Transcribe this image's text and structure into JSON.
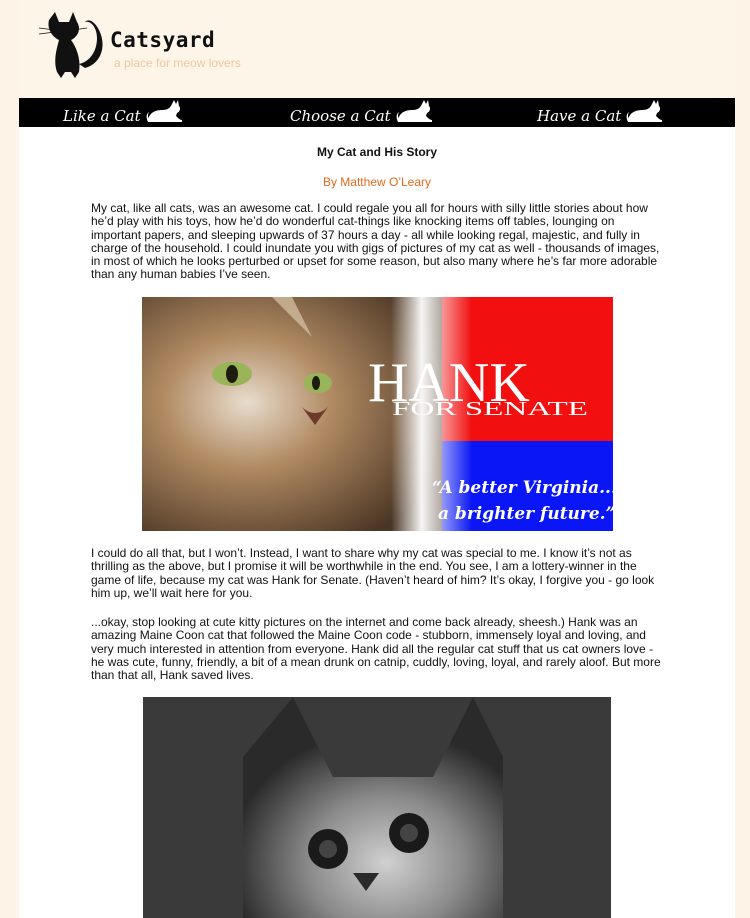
{
  "site": {
    "title": "Catsyard",
    "tagline": "a place for meow lovers"
  },
  "nav": {
    "items": [
      {
        "label": "Like a Cat",
        "icon": "cat-icon"
      },
      {
        "label": "Choose a Cat",
        "icon": "cat-icon"
      },
      {
        "label": "Have a Cat",
        "icon": "cat-icon"
      }
    ]
  },
  "article": {
    "title": "My Cat and His Story",
    "author": "By Matthew O’Leary",
    "paragraphs": [
      "My cat, like all cats, was an awesome cat. I could regale you all for hours with silly little stories about how he’d play with his toys, how he’d do wonderful cat-things like knocking items off tables, lounging on important papers, and sleeping upwards of 37 hours a day - all while looking regal, majestic, and fully in charge of the household. I could inundate you with gigs of pictures of my cat as well - thousands of images, in most of which he looks perturbed or upset for some reason, but also many where he’s far more adorable than any human babies I’ve seen.",
      "I could do all that, but I won’t. Instead, I want to share why my cat was special to me. I know it’s not as thrilling as the above, but I promise it will be worthwhile in the end. You see, I am a lottery-winner in the game of life, because my cat was Hank for Senate. (Haven’t heard of him? It’s okay, I forgive you - go look him up, we’ll wait here for you.",
      "...okay, stop looking at cute kitty pictures on the internet and come back already, sheesh.) Hank was an amazing Maine Coon cat that followed the Maine Coon code - stubborn, immensely loyal and loving, and very much interested in attention from everyone. Hank did all the regular cat stuff that us cat owners love - he was cute, funny, friendly, a bit of a mean drunk on catnip, cuddly, loving, loyal, and rarely aloof. But more than that all, Hank saved lives."
    ],
    "poster": {
      "name": "HANK",
      "subtitle": "FOR SENATE",
      "slogan_line1": "“A better Virginia...",
      "slogan_line2": "a brighter future.”"
    }
  },
  "colors": {
    "background": "#fdf3e6",
    "nav_bg": "#000000",
    "author": "#e06a1c",
    "tagline": "#f1c59a",
    "poster_red": "#f10f0f",
    "poster_blue": "#0a16f5"
  }
}
